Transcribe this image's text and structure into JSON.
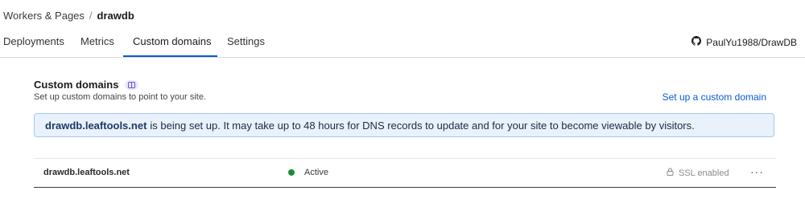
{
  "breadcrumb": {
    "parent": "Workers & Pages",
    "separator": "/",
    "current": "drawdb"
  },
  "tabs": [
    {
      "label": "Deployments"
    },
    {
      "label": "Metrics"
    },
    {
      "label": "Custom domains",
      "active": true
    },
    {
      "label": "Settings"
    }
  ],
  "repo": {
    "icon": "github-icon",
    "label": "PaulYu1988/DrawDB"
  },
  "section": {
    "title": "Custom domains",
    "badge_icon": "docs-icon",
    "description": "Set up custom domains to point to your site.",
    "action_label": "Set up a custom domain"
  },
  "banner": {
    "domain": "drawdb.leaftools.net",
    "message": "is being set up. It may take up to 48 hours for DNS records to update and for your site to become viewable by visitors."
  },
  "domains": [
    {
      "name": "drawdb.leaftools.net",
      "status": "Active",
      "status_color": "#1f8a3b",
      "ssl": "SSL enabled",
      "menu": "···"
    }
  ],
  "colors": {
    "accent": "#0a5bd3",
    "banner_bg": "#e8f1fc",
    "banner_border": "#a8c7ef"
  }
}
